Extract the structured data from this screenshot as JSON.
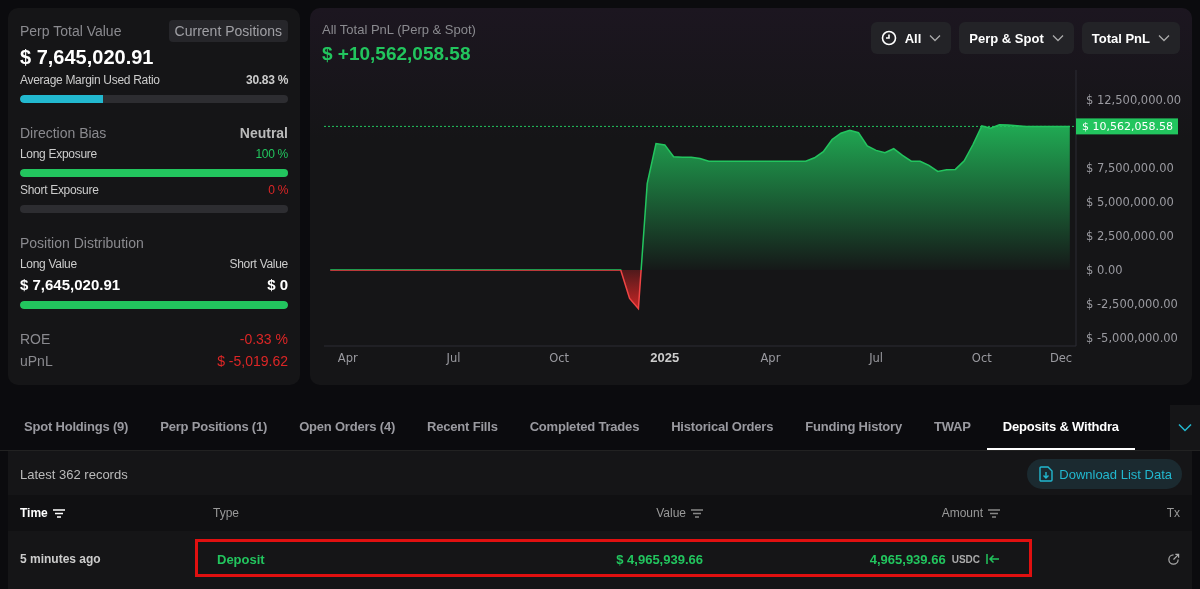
{
  "summary": {
    "title": "Perp Total Value",
    "badge": "Current Positions",
    "total": "$ 7,645,020.91",
    "margin": {
      "label": "Average Margin Used Ratio",
      "value": "30.83 %",
      "level": 0.3083
    },
    "bias": {
      "title": "Direction Bias",
      "value": "Neutral"
    },
    "exposures": [
      {
        "label": "Long Exposure",
        "value": "100 %",
        "level": 1.0,
        "kind": "long"
      },
      {
        "label": "Short Exposure",
        "value": "0 %",
        "level": 0,
        "kind": "short"
      }
    ],
    "distribution": {
      "title": "Position Distribution",
      "long_label": "Long Value",
      "short_label": "Short Value",
      "long_value": "$ 7,645,020.91",
      "short_value": "$ 0",
      "level": 1.0
    },
    "metrics": [
      {
        "label": "ROE",
        "value": "-0.33 %"
      },
      {
        "label": "uPnL",
        "value": "$ -5,019.62"
      }
    ]
  },
  "pnl": {
    "title": "All Total PnL (Perp & Spot)",
    "value": "$ +10,562,058.58",
    "filters": [
      {
        "label": "All",
        "icon": true
      },
      {
        "label": "Perp & Spot",
        "icon": false
      },
      {
        "label": "Total PnL",
        "icon": false
      }
    ],
    "chart_data": {
      "type": "area",
      "categories": [
        null,
        null,
        "Apr",
        null,
        null,
        null,
        null,
        null,
        null,
        null,
        null,
        null,
        null,
        null,
        "Jul",
        null,
        null,
        null,
        null,
        null,
        null,
        null,
        null,
        null,
        null,
        null,
        "Oct",
        null,
        null,
        null,
        null,
        null,
        null,
        null,
        null,
        null,
        null,
        null,
        "2025",
        null,
        null,
        null,
        null,
        null,
        null,
        null,
        null,
        null,
        null,
        null,
        "Apr",
        null,
        null,
        null,
        null,
        null,
        null,
        null,
        null,
        null,
        null,
        null,
        "Jul",
        null,
        null,
        null,
        null,
        null,
        null,
        null,
        null,
        null,
        null,
        null,
        "Oct",
        null,
        null,
        null,
        null,
        null,
        null,
        null,
        null,
        "Dec",
        null
      ],
      "series": [
        {
          "color": "#22c55e",
          "values": [
            0,
            0,
            0,
            0,
            0,
            0,
            0,
            0,
            0,
            0,
            0,
            0,
            0,
            0,
            0,
            0,
            0,
            0,
            0,
            0,
            0,
            0,
            0,
            0,
            0,
            0,
            0,
            0,
            0,
            0,
            0,
            0,
            0,
            0,
            -2100000,
            -2850000,
            6350000,
            9300000,
            9200000,
            8330000,
            8300000,
            8300000,
            8200000,
            8000000,
            8000000,
            8000000,
            8000000,
            8000000,
            8000000,
            8000000,
            8000000,
            8000000,
            8000000,
            8000000,
            8000000,
            8250000,
            8700000,
            9600000,
            10060000,
            10280000,
            10100000,
            9120000,
            8800000,
            8630000,
            8920000,
            8430000,
            8000000,
            8000000,
            7690000,
            7250000,
            7370000,
            7400000,
            8030000,
            9230000,
            10600000,
            10430000,
            10690000,
            10670000,
            10610000,
            10560000,
            10560000,
            10560000,
            10560000,
            10560000,
            10560000
          ]
        }
      ],
      "ylim": [
        -5590000,
        14710000
      ],
      "yticks": [
        {
          "value": 12500000,
          "label": "$ 12,500,000.00"
        },
        {
          "value": 7500000,
          "label": "$ 7,500,000.00"
        },
        {
          "value": 5000000,
          "label": "$ 5,000,000.00"
        },
        {
          "value": 2500000,
          "label": "$ 2,500,000.00"
        },
        {
          "value": 0,
          "label": "$ 0.00"
        },
        {
          "value": -2500000,
          "label": "$ -2,500,000.00"
        },
        {
          "value": -5000000,
          "label": "$ -5,000,000.00"
        }
      ],
      "ref_lines": [
        {
          "axis": "y",
          "value": 10562058.58,
          "label": "$ 10,562,058.58"
        }
      ]
    }
  },
  "tabs": [
    {
      "label": "Spot Holdings (9)",
      "selected": false
    },
    {
      "label": "Perp Positions (1)",
      "selected": false
    },
    {
      "label": "Open Orders (4)",
      "selected": false
    },
    {
      "label": "Recent Fills",
      "selected": false
    },
    {
      "label": "Completed Trades",
      "selected": false
    },
    {
      "label": "Historical Orders",
      "selected": false
    },
    {
      "label": "Funding History",
      "selected": false
    },
    {
      "label": "TWAP",
      "selected": false
    },
    {
      "label": "Deposits & Withdra",
      "selected": true
    }
  ],
  "records": "Latest 362 records",
  "download": "Download List Data",
  "table": {
    "columns": [
      {
        "label": "Time",
        "sortable": true
      },
      {
        "label": "Type",
        "sortable": false
      },
      {
        "label": "Value",
        "sortable": true
      },
      {
        "label": "Amount",
        "sortable": true
      },
      {
        "label": "Tx",
        "sortable": false
      }
    ],
    "rows": [
      {
        "time": "5 minutes ago",
        "type": "Deposit",
        "value": "$ 4,965,939.66",
        "amount": "4,965,939.66",
        "token": "USDC",
        "highlighted": true
      }
    ]
  }
}
